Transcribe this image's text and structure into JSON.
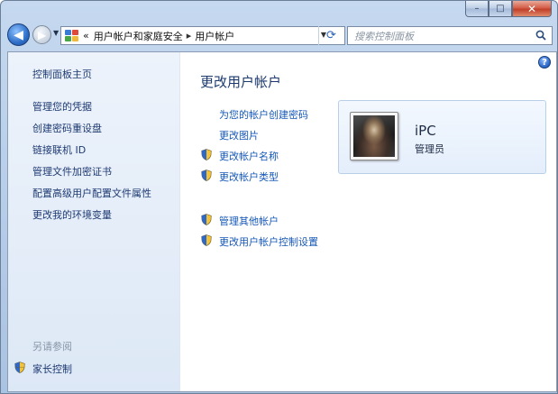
{
  "window": {
    "caption_min": "–",
    "caption_max": "□",
    "caption_close": "✕"
  },
  "address": {
    "overflow": "«",
    "crumbs": [
      "用户帐户和家庭安全",
      "用户帐户"
    ],
    "separator": "▸",
    "search_placeholder": "搜索控制面板"
  },
  "sidebar": {
    "home_link": "控制面板主页",
    "links": [
      "管理您的凭据",
      "创建密码重设盘",
      "链接联机 ID",
      "管理文件加密证书",
      "配置高级用户配置文件属性",
      "更改我的环境变量"
    ],
    "see_also_title": "另请参阅",
    "see_also_links": [
      "家长控制"
    ]
  },
  "main": {
    "title": "更改用户帐户",
    "tasks": [
      "为您的帐户创建密码",
      "更改图片",
      "更改帐户名称",
      "更改帐户类型"
    ],
    "other_tasks": [
      "管理其他帐户",
      "更改用户帐户控制设置"
    ]
  },
  "user": {
    "name": "iPC",
    "role": "管理员"
  },
  "colors": {
    "link": "#1658b8",
    "sidebar_link": "#1e3a73",
    "title": "#1c3a6e",
    "sidebar_bg": "#e6eef9"
  }
}
